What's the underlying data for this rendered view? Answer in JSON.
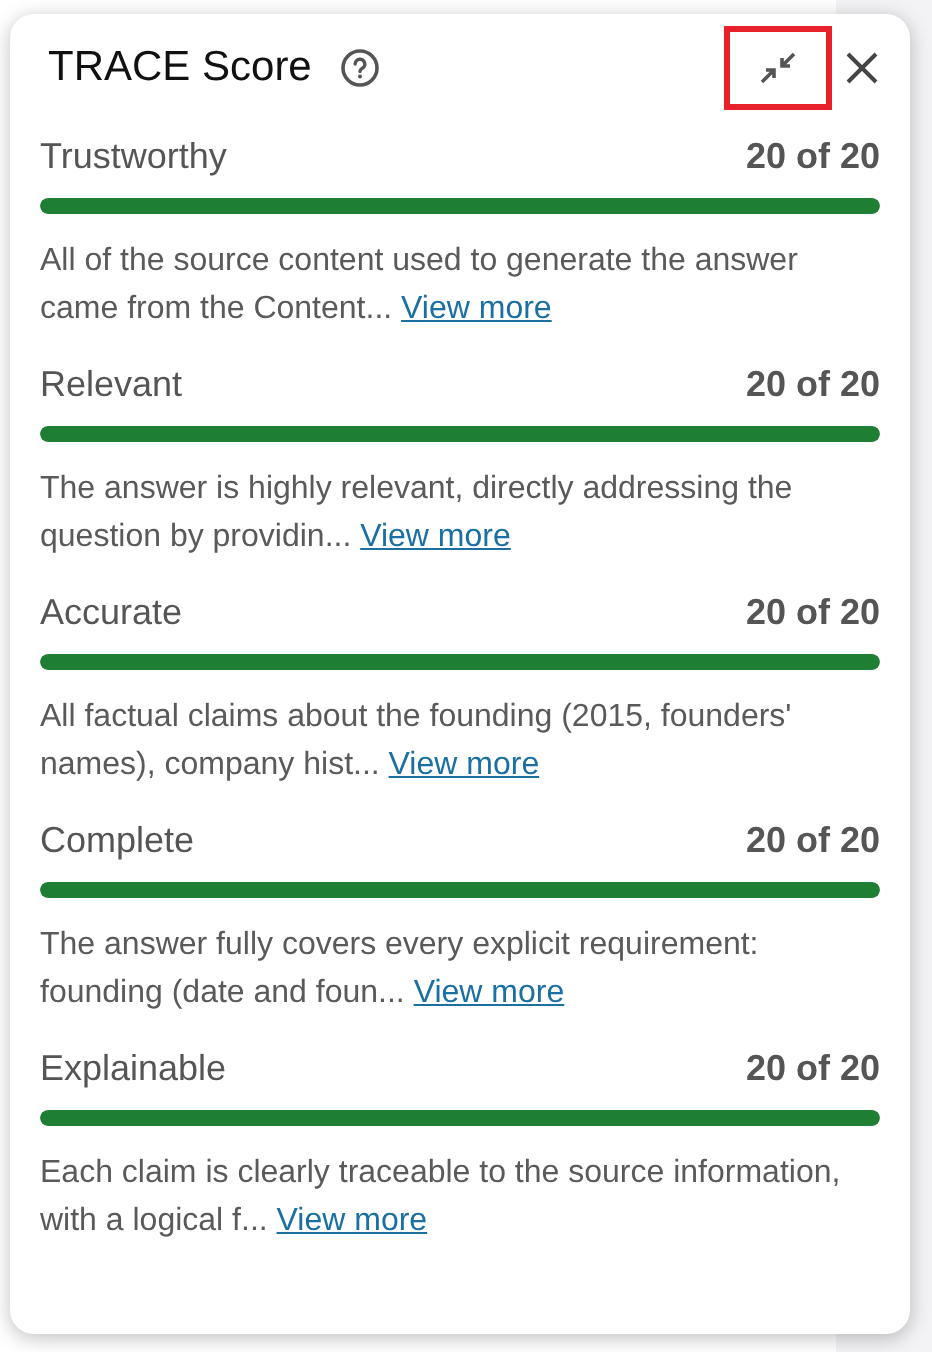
{
  "panel": {
    "title": "TRACE Score",
    "minimize_highlighted": true,
    "criteria": [
      {
        "name": "Trustworthy",
        "score": "20 of 20",
        "level": 1,
        "summary": "All of the source content used to generate the answer came from the Content...",
        "link": "View more"
      },
      {
        "name": "Relevant",
        "score": "20 of 20",
        "level": 1,
        "summary": "The answer is highly relevant, directly addressing the question by providin...",
        "link": "View more"
      },
      {
        "name": "Accurate",
        "score": "20 of 20",
        "level": 1,
        "summary": "All factual claims about the founding (2015, founders' names), company hist...",
        "link": "View more"
      },
      {
        "name": "Complete",
        "score": "20 of 20",
        "level": 1,
        "summary": "The answer fully covers every explicit requirement: founding (date and foun...",
        "link": "View more"
      },
      {
        "name": "Explainable",
        "score": "20 of 20",
        "level": 1,
        "summary": "Each claim is clearly traceable to the source information, with a logical f...",
        "link": "View more"
      }
    ]
  }
}
